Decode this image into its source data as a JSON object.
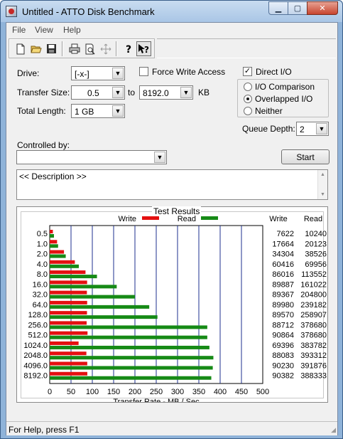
{
  "window": {
    "title": "Untitled - ATTO Disk Benchmark"
  },
  "menu": [
    "File",
    "View",
    "Help"
  ],
  "toolbar": [
    "new-icon",
    "open-icon",
    "save-icon",
    "print-icon",
    "print-preview-icon",
    "move-icon",
    "help-icon",
    "context-help-icon"
  ],
  "form": {
    "drive_label": "Drive:",
    "drive_value": "[-x-]",
    "force_write_label": "Force Write Access",
    "force_write_checked": false,
    "direct_io_label": "Direct I/O",
    "direct_io_checked": true,
    "transfer_size_label": "Transfer Size:",
    "transfer_from": "0.5",
    "to_label": "to",
    "transfer_to": "8192.0",
    "kb_label": "KB",
    "total_length_label": "Total Length:",
    "total_length": "1 GB",
    "io_options": [
      {
        "label": "I/O Comparison",
        "selected": false
      },
      {
        "label": "Overlapped I/O",
        "selected": true
      },
      {
        "label": "Neither",
        "selected": false
      }
    ],
    "queue_depth_label": "Queue Depth:",
    "queue_depth": "2",
    "controlled_by_label": "Controlled by:",
    "controlled_by_value": "",
    "start_label": "Start",
    "description": "<< Description >>"
  },
  "results": {
    "caption": "Test Results",
    "write_col": "Write",
    "read_col": "Read"
  },
  "chart_data": {
    "type": "bar",
    "title": "Test Results",
    "xlabel": "Transfer Rate - MB / Sec",
    "xlim": [
      0,
      500
    ],
    "xticks": [
      "0",
      "50",
      "100",
      "150",
      "200",
      "250",
      "300",
      "350",
      "400",
      "450",
      "500"
    ],
    "orientation": "horizontal",
    "legend": [
      "Write",
      "Read"
    ],
    "grid": true,
    "colors": {
      "write": "#e41010",
      "read": "#168a16"
    },
    "categories": [
      "0.5",
      "1.0",
      "2.0",
      "4.0",
      "8.0",
      "16.0",
      "32.0",
      "64.0",
      "128.0",
      "256.0",
      "512.0",
      "1024.0",
      "2048.0",
      "4096.0",
      "8192.0"
    ],
    "series": [
      {
        "name": "Write",
        "values": [
          7622,
          17664,
          34304,
          60416,
          86016,
          89887,
          89367,
          89980,
          89570,
          88712,
          90864,
          69396,
          88083,
          90230,
          90382
        ]
      },
      {
        "name": "Read",
        "values": [
          10240,
          20123,
          38526,
          69956,
          113552,
          161022,
          204800,
          239182,
          258907,
          378680,
          378680,
          383782,
          393312,
          391876,
          388333
        ]
      }
    ]
  },
  "status": {
    "text": "For Help, press F1"
  }
}
